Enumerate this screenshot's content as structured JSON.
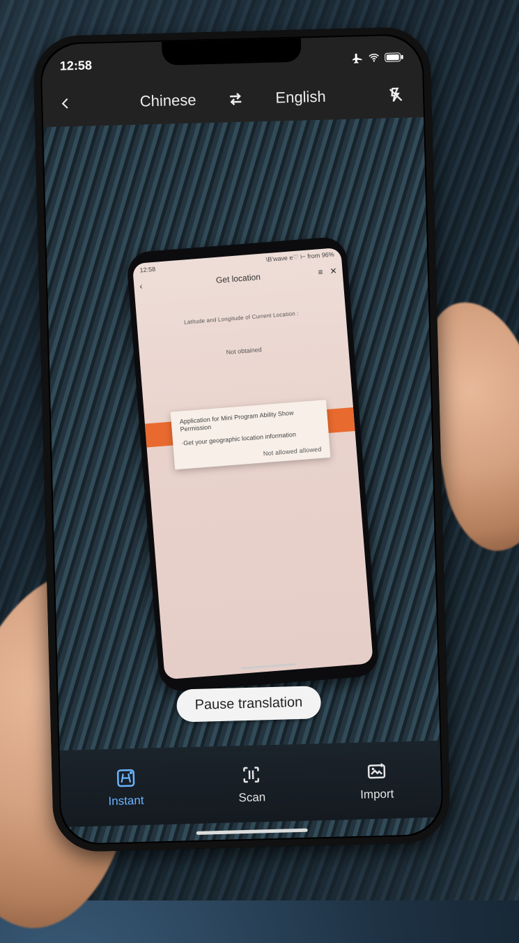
{
  "statusbar": {
    "time": "12:58"
  },
  "langbar": {
    "source": "Chinese",
    "target": "English"
  },
  "inner": {
    "statusbar": {
      "time": "12:58",
      "right": "\\B'wave  e♡ ⊢  from  96%"
    },
    "header_title": "Get location",
    "line1": "Latitude and Longitude of Current Location :",
    "line2": "Not obtained",
    "dialog": {
      "title": "Application for Mini Program Ability Show Permission",
      "body": "·Get your geographic location information",
      "actions": "Not allowed  allowed"
    }
  },
  "pause_label": "Pause translation",
  "tabs": {
    "instant": "Instant",
    "scan": "Scan",
    "import": "Import"
  }
}
